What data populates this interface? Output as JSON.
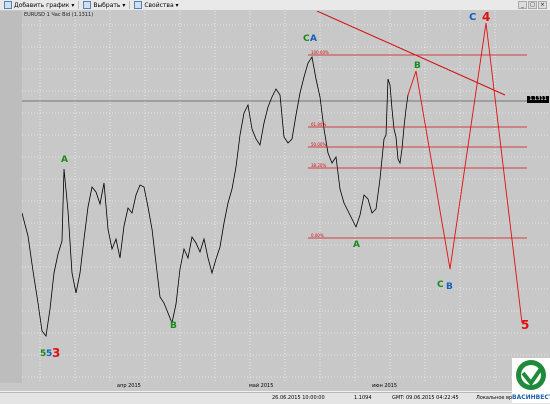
{
  "toolbar": {
    "items": [
      {
        "label": "Добавить график",
        "icon": "add-chart-icon"
      },
      {
        "label": "Выбрать",
        "icon": "select-icon"
      },
      {
        "label": "Свойства",
        "icon": "properties-icon"
      }
    ]
  },
  "window_buttons": [
    "_",
    "□",
    "×"
  ],
  "chart": {
    "title": "EURUSD 1 Час Bid (1.1311)",
    "current_price_label": "1.1311",
    "time_axis": [
      "апр 2015",
      "май 2015",
      "июн 2015"
    ],
    "colors": {
      "bg": "#c8c8c8",
      "price": "#000000",
      "fib": "#d01010",
      "trend": "#d01010",
      "wave_green": "#1a8a1a",
      "wave_blue": "#1060c0",
      "wave_red": "#e01010"
    }
  },
  "wave_labels": [
    {
      "text": "A",
      "color": "#1a8a1a"
    },
    {
      "text": "C",
      "color": "#1a8a1a"
    },
    {
      "text": "A",
      "color": "#1060c0"
    },
    {
      "text": "B",
      "color": "#1a8a1a"
    },
    {
      "text": "A",
      "color": "#1a8a1a"
    },
    {
      "text": "B",
      "color": "#1a8a1a"
    },
    {
      "text": "C",
      "color": "#1a8a1a"
    },
    {
      "text": "B",
      "color": "#1060c0"
    },
    {
      "text": "C",
      "color": "#1060c0"
    },
    {
      "text": "4",
      "color": "#e01010"
    },
    {
      "text": "5",
      "color": "#e01010"
    },
    {
      "text": "5",
      "color": "#1a8a1a"
    },
    {
      "text": "5",
      "color": "#1060c0"
    },
    {
      "text": "3",
      "color": "#e01010"
    }
  ],
  "fib_levels": [
    "100.00%",
    "61.80%",
    "50.00%",
    "38.20%",
    "0.00%"
  ],
  "status_bar": {
    "datetime": "26.06.2015 10:00:00",
    "price": "1.1094",
    "gmt": "GMT: 09.06.2015 04:22:45",
    "local": "Локальное вре"
  },
  "logo": {
    "text": "ВАСИНВЕСТ"
  }
}
